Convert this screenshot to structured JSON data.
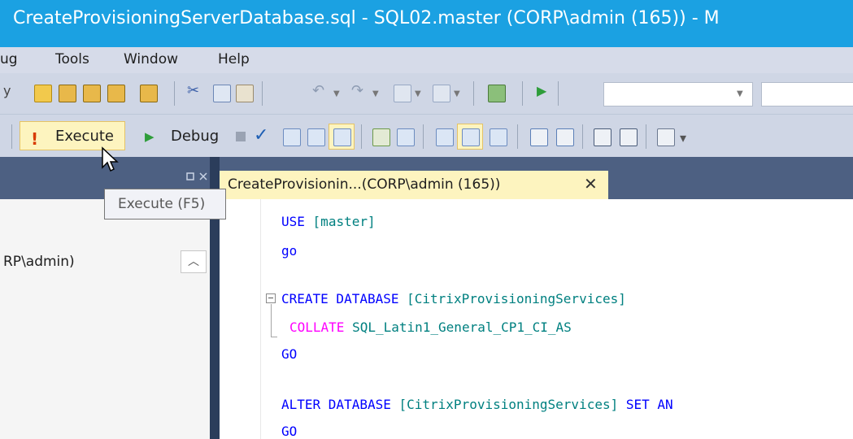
{
  "window": {
    "title": "CreateProvisioningServerDatabase.sql - SQL02.master (CORP\\admin (165)) - M"
  },
  "menu": [
    "ug",
    "Tools",
    "Window",
    "Help"
  ],
  "toolbar": {
    "execute_label": "Execute",
    "debug_label": "Debug",
    "execute_tooltip": "Execute (F5)"
  },
  "left_panel": {
    "connection_label": "RP\\admin)"
  },
  "tabs": [
    {
      "label": "CreateProvisionin...(CORP\\admin (165))",
      "active": true
    }
  ],
  "editor": {
    "line1_kw": "USE",
    "line1_db": "[master]",
    "line2": "go",
    "line3_kw": "CREATE DATABASE",
    "line3_db": "[CitrixProvisioningServices]",
    "line4_kw": "COLLATE",
    "line4_val": "SQL_Latin1_General_CP1_CI_AS",
    "line5": "GO",
    "line6_kw": "ALTER DATABASE",
    "line6_db": "[CitrixProvisioningServices]",
    "line6_set": "SET AN",
    "line7": "GO"
  },
  "icons": [
    "new-query-icon",
    "database-query-icon",
    "cut-icon",
    "copy-icon",
    "paste-icon",
    "undo-icon",
    "redo-icon",
    "start-icon",
    "execute-icon",
    "debug-icon",
    "stop-icon",
    "parse-icon",
    "close-icon",
    "cursor-icon"
  ],
  "colors": {
    "title_bg": "#1ba1e2",
    "toolbar_bg": "#cfd6e5",
    "panel_bg": "#4d6082",
    "active_tab": "#fdf4bf"
  }
}
